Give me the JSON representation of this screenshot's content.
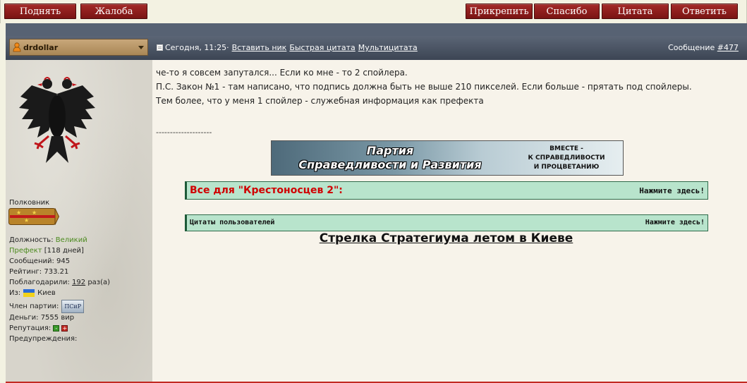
{
  "toolbar": {
    "raise": "Поднять",
    "complain": "Жалоба",
    "pin": "Прикрепить",
    "thanks": "Спасибо",
    "quote": "Цитата",
    "reply": "Ответить"
  },
  "post": {
    "username": "drdollar",
    "date": "Сегодня, 11:25·",
    "insert_nick": "Вставить ник",
    "quick_quote": "Быстрая цитата",
    "multiquote": "Мультицитата",
    "message_label": "Сообщение",
    "message_number": "#477"
  },
  "profile": {
    "rank": "Полковник",
    "position_label": "Должность:",
    "position_value_1": "Великий",
    "position_value_2": "Префект",
    "position_days": "[118 дней]",
    "messages": "Сообщений: 945",
    "rating": "Рейтинг: 733.21",
    "thanked_label": "Поблагодарили:",
    "thanked_count": "192",
    "thanked_suffix": "раз(а)",
    "from_label": "Из:",
    "from_city": "Киев",
    "party_label": "Член партии:",
    "party_badge": "ПСиР",
    "money": "Деньги: 7555 вир",
    "reputation_label": "Репутация:",
    "warnings_label": "Предупреждения:"
  },
  "message": {
    "line1": "че-то я совсем запутался... Если ко мне - то 2 спойлера.",
    "line2": "П.С. Закон №1 - там написано, что подпись должна быть не выше 210 пикселей. Если больше - прятать под спойлеры.",
    "line3": "Тем более, что у меня 1 спойлер - служебная информация как префекта",
    "separator": "--------------------"
  },
  "signature": {
    "banner_party_1": "Партия",
    "banner_party_2": "Справедливости и Развития",
    "banner_slogan_1": "ВМЕСТЕ -",
    "banner_slogan_2": "К СПРАВЕДЛИВОСТИ",
    "banner_slogan_3": "И ПРОЦВЕТАНИЮ",
    "spoiler1_title": "Все для \"Крестоносцев 2\":",
    "spoiler1_action": "Нажмите здесь!",
    "spoiler2_title": "Цитаты пользователей",
    "spoiler2_action": "Нажмите здесь!",
    "meetup_link": "Стрелка Стратегиума летом в Киеве"
  },
  "colors": {
    "button_red": "#8e1f1d",
    "header_grey": "#4b5464",
    "spoiler_green": "#b8e4cc",
    "spoiler_title_red": "#d00000",
    "link_green": "#4b8a1e"
  }
}
